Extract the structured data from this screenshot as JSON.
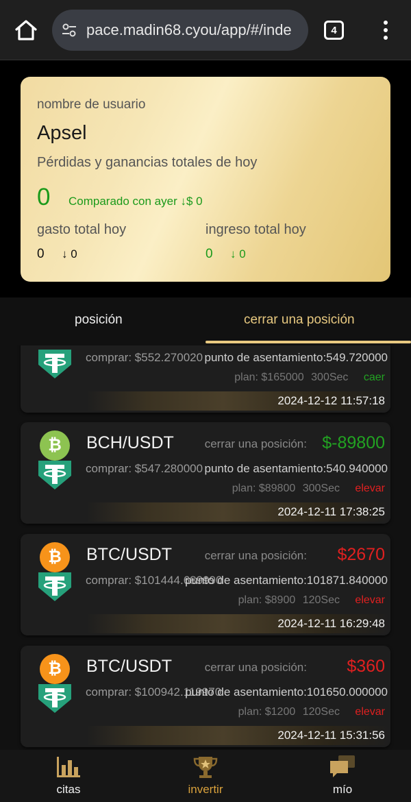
{
  "browser": {
    "url": "pace.madin68.cyou/app/#/inde",
    "tab_count": "4"
  },
  "summary": {
    "username_label": "nombre de usuario",
    "username": "Apsel",
    "pl_label": "Pérdidas y ganancias totales de hoy",
    "pl_value": "0",
    "compare_text": "Comparado con ayer ↓$ 0",
    "spend_label": "gasto total hoy",
    "spend_value": "0",
    "spend_change": "↓ 0",
    "income_label": "ingreso total hoy",
    "income_value": "0",
    "income_change": "↓ 0"
  },
  "tabs": {
    "position": "posición",
    "close_position": "cerrar una posición"
  },
  "orders": [
    {
      "pair": "",
      "close_label": "",
      "close_value": "",
      "buy": "comprar:  $552.270020",
      "settle": "punto de asentamiento:549.720000",
      "plan_amount": "plan:  $165000",
      "plan_time": "300Sec",
      "direction": "caer",
      "time": "2024-12-12 11:57:18"
    },
    {
      "pair": "BCH/USDT",
      "close_label": "cerrar una posición:",
      "close_value": "$-89800",
      "buy": "comprar:  $547.280000",
      "settle": "punto de asentamiento:540.940000",
      "plan_amount": "plan:  $89800",
      "plan_time": "300Sec",
      "direction": "elevar",
      "time": "2024-12-11 17:38:25"
    },
    {
      "pair": "BTC/USDT",
      "close_label": "cerrar una posición:",
      "close_value": "$2670",
      "buy": "comprar:  $101444.689990",
      "settle": "punto de asentamiento:101871.840000",
      "plan_amount": "plan:  $8900",
      "plan_time": "120Sec",
      "direction": "elevar",
      "time": "2024-12-11 16:29:48"
    },
    {
      "pair": "BTC/USDT",
      "close_label": "cerrar una posición:",
      "close_value": "$360",
      "buy": "comprar:  $100942.119970",
      "settle": "punto de asentamiento:101650.000000",
      "plan_amount": "plan:  $1200",
      "plan_time": "120Sec",
      "direction": "elevar",
      "time": "2024-12-11 15:31:56"
    }
  ],
  "nav": {
    "citas": "citas",
    "invertir": "invertir",
    "mio": "mío"
  },
  "colors": {
    "accent_gold": "#e8c980",
    "profit_red": "#e02020",
    "loss_green": "#22a322"
  }
}
